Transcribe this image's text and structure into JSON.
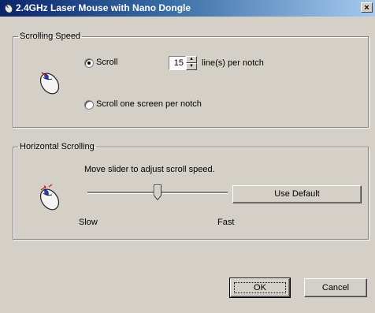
{
  "window": {
    "title": "2.4GHz Laser Mouse with Nano Dongle",
    "close_label": "×"
  },
  "scrolling_speed": {
    "group_label": "Scrolling Speed",
    "option_scroll_label": "Scroll",
    "lines_value": "15",
    "lines_suffix": "line(s) per notch",
    "option_screen_label": "Scroll one screen per notch",
    "selected": "scroll"
  },
  "horizontal_scrolling": {
    "group_label": "Horizontal Scrolling",
    "instruction": "Move slider to adjust scroll speed.",
    "use_default_label": "Use Default",
    "slow_label": "Slow",
    "fast_label": "Fast",
    "slider_value": 0.5
  },
  "footer": {
    "ok_label": "OK",
    "cancel_label": "Cancel"
  },
  "icons": {
    "title": "mouse-icon",
    "scroll_group": "mouse-wheel-icon",
    "horizontal_group": "mouse-tilt-icon"
  }
}
